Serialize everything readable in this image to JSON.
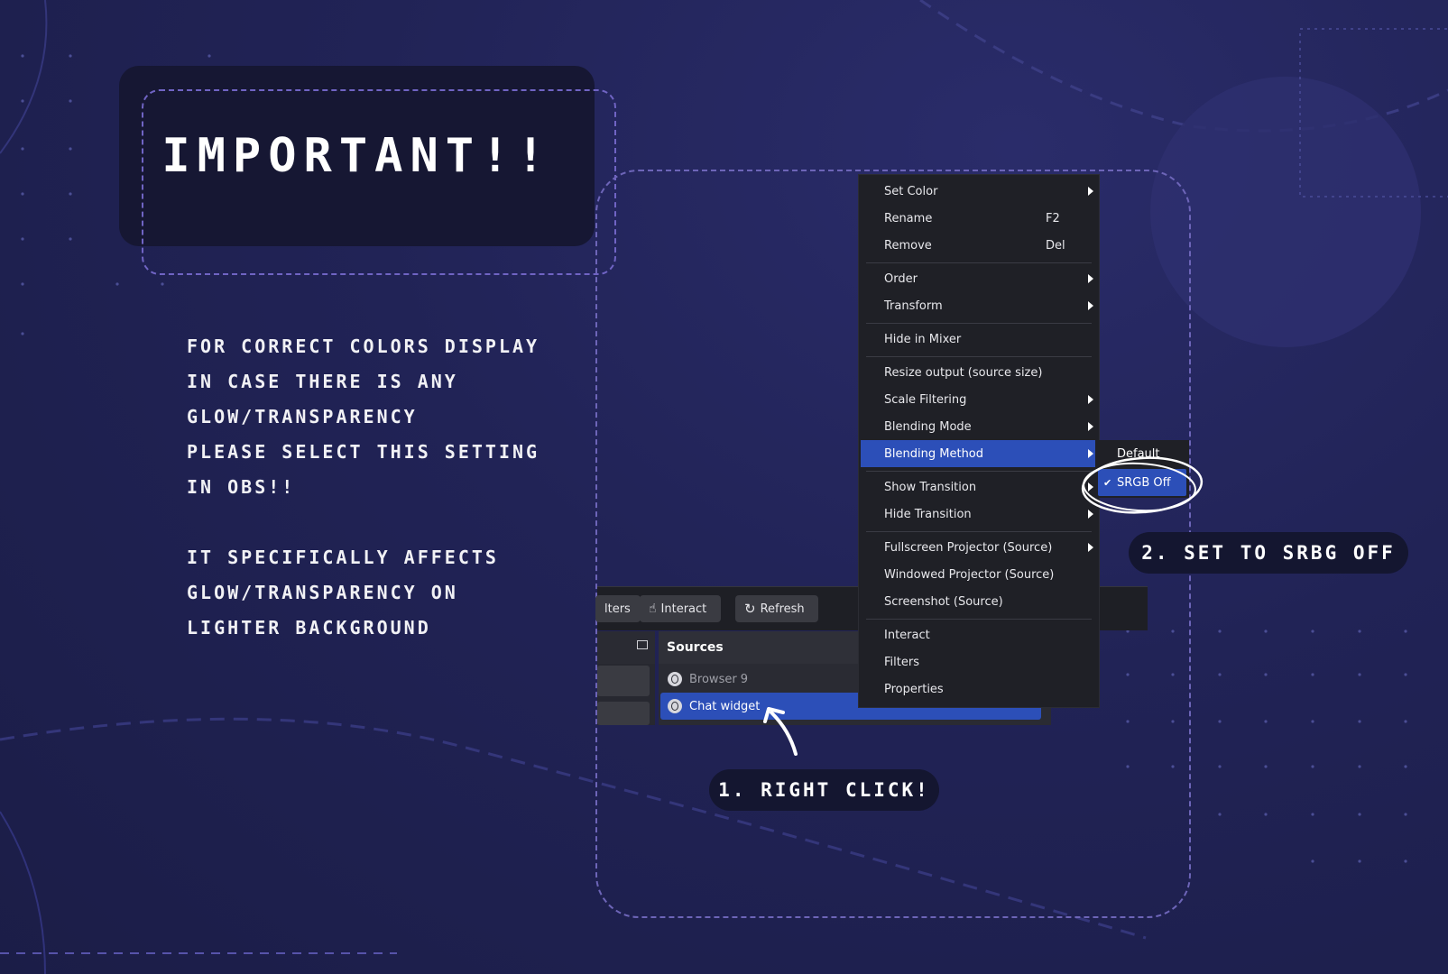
{
  "title": "IMPORTANT!!",
  "notes": {
    "lines1": [
      "FOR CORRECT COLORS DISPLAY",
      "IN CASE THERE IS ANY",
      "GLOW/TRANSPARENCY",
      "PLEASE SELECT THIS SETTING",
      "IN OBS!!"
    ],
    "lines2": [
      "IT SPECIFICALLY AFFECTS",
      "GLOW/TRANSPARENCY ON",
      "LIGHTER BACKGROUND"
    ]
  },
  "toolbar": {
    "filters_label": "lters",
    "interact_label": "Interact",
    "refresh_label": "Refresh"
  },
  "sources": {
    "header": "Sources",
    "items": [
      "Browser 9",
      "Chat widget"
    ]
  },
  "context_menu": {
    "items": [
      {
        "label": "Set Color",
        "submenu": true
      },
      {
        "label": "Rename",
        "shortcut": "F2"
      },
      {
        "label": "Remove",
        "shortcut": "Del"
      },
      {
        "label": "Order",
        "submenu": true
      },
      {
        "label": "Transform",
        "submenu": true
      },
      {
        "label": "Hide in Mixer"
      },
      {
        "label": "Resize output (source size)"
      },
      {
        "label": "Scale Filtering",
        "submenu": true
      },
      {
        "label": "Blending Mode",
        "submenu": true
      },
      {
        "label": "Blending Method",
        "submenu": true,
        "highlighted": true
      },
      {
        "label": "Show Transition",
        "submenu": true
      },
      {
        "label": "Hide Transition",
        "submenu": true
      },
      {
        "label": "Fullscreen Projector (Source)",
        "submenu": true
      },
      {
        "label": "Windowed Projector (Source)"
      },
      {
        "label": "Screenshot (Source)"
      },
      {
        "label": "Interact"
      },
      {
        "label": "Filters"
      },
      {
        "label": "Properties"
      }
    ]
  },
  "submenu": {
    "items": [
      "Default",
      "SRGB Off"
    ],
    "selected": "SRGB Off"
  },
  "steps": {
    "step1": "1. RIGHT CLICK!",
    "step2": "2. SET TO SRBG OFF"
  },
  "colors": {
    "accent": "#2c4fb8",
    "dash": "#6d65b8",
    "background": "#212356"
  }
}
